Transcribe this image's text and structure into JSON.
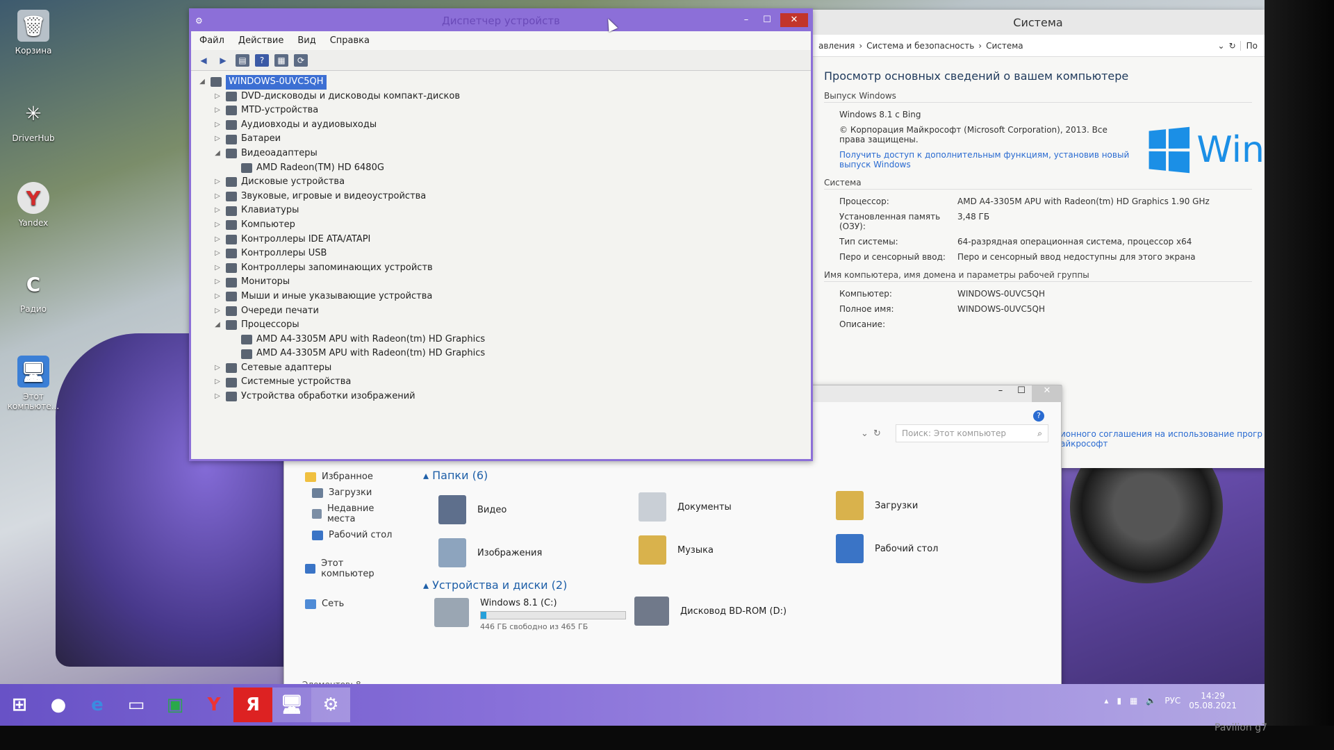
{
  "desktop": {
    "icons": [
      {
        "label": "Корзина",
        "icon": "recycle-bin-icon"
      },
      {
        "label": "DriverHub",
        "icon": "driverhub-icon"
      },
      {
        "label": "Yandex",
        "icon": "yandex-browser-icon"
      },
      {
        "label": "Радио",
        "icon": "radio-icon"
      },
      {
        "label": "Этот компьюте...",
        "icon": "computer-icon"
      }
    ]
  },
  "device_manager": {
    "title": "Диспетчер устройств",
    "menu": [
      "Файл",
      "Действие",
      "Вид",
      "Справка"
    ],
    "tree": [
      {
        "label": "WINDOWS-0UVC5QH",
        "expanded": true,
        "level": 0
      },
      {
        "label": "DVD-дисководы и дисководы компакт-дисков",
        "level": 1
      },
      {
        "label": "MTD-устройства",
        "level": 1
      },
      {
        "label": "Аудиовходы и аудиовыходы",
        "level": 1
      },
      {
        "label": "Батареи",
        "level": 1
      },
      {
        "label": "Видеоадаптеры",
        "level": 1,
        "expanded": true
      },
      {
        "label": "AMD Radeon(TM) HD 6480G",
        "level": 2
      },
      {
        "label": "Дисковые устройства",
        "level": 1
      },
      {
        "label": "Звуковые, игровые и видеоустройства",
        "level": 1
      },
      {
        "label": "Клавиатуры",
        "level": 1
      },
      {
        "label": "Компьютер",
        "level": 1
      },
      {
        "label": "Контроллеры IDE ATA/ATAPI",
        "level": 1
      },
      {
        "label": "Контроллеры USB",
        "level": 1
      },
      {
        "label": "Контроллеры запоминающих устройств",
        "level": 1
      },
      {
        "label": "Мониторы",
        "level": 1
      },
      {
        "label": "Мыши и иные указывающие устройства",
        "level": 1
      },
      {
        "label": "Очереди печати",
        "level": 1
      },
      {
        "label": "Процессоры",
        "level": 1,
        "expanded": true
      },
      {
        "label": "AMD A4-3305M APU with Radeon(tm) HD Graphics",
        "level": 2
      },
      {
        "label": "AMD A4-3305M APU with Radeon(tm) HD Graphics",
        "level": 2
      },
      {
        "label": "Сетевые адаптеры",
        "level": 1
      },
      {
        "label": "Системные устройства",
        "level": 1
      },
      {
        "label": "Устройства обработки изображений",
        "level": 1
      }
    ]
  },
  "system": {
    "title": "Система",
    "breadcrumb": [
      "авления",
      "Система и безопасность",
      "Система"
    ],
    "search_stub": "По",
    "heading": "Просмотр основных сведений о вашем компьютере",
    "edition_label": "Выпуск Windows",
    "edition": "Windows 8.1 с Bing",
    "copyright": "© Корпорация Майкрософт (Microsoft Corporation), 2013. Все права защищены.",
    "upgrade_link": "Получить доступ к дополнительным функциям, установив новый выпуск Windows",
    "logo_text": "Win",
    "system_label": "Система",
    "rows": [
      {
        "k": "Процессор:",
        "v": "AMD A4-3305M APU with Radeon(tm) HD Graphics   1.90 GHz"
      },
      {
        "k": "Установленная память (ОЗУ):",
        "v": "3,48 ГБ"
      },
      {
        "k": "Тип системы:",
        "v": "64-разрядная операционная система, процессор x64"
      },
      {
        "k": "Перо и сенсорный ввод:",
        "v": "Перо и сенсорный ввод недоступны для этого экрана"
      }
    ],
    "name_label": "Имя компьютера, имя домена и параметры рабочей группы",
    "name_rows": [
      {
        "k": "Компьютер:",
        "v": "WINDOWS-0UVC5QH"
      },
      {
        "k": "Полное имя:",
        "v": "WINDOWS-0UVC5QH"
      },
      {
        "k": "Описание:",
        "v": ""
      }
    ],
    "license_link": "ионного соглашения на использование прогр",
    "license_link2": "айкрософт"
  },
  "explorer": {
    "search_placeholder": "Поиск: Этот компьютер",
    "nav": [
      {
        "label": "Избранное",
        "sub": false
      },
      {
        "label": "Загрузки",
        "sub": true
      },
      {
        "label": "Недавние места",
        "sub": true
      },
      {
        "label": "Рабочий стол",
        "sub": true
      },
      {
        "label": "Этот компьютер",
        "sub": false
      },
      {
        "label": "Сеть",
        "sub": false
      }
    ],
    "folders_header": "Папки (6)",
    "folders": [
      "Видео",
      "Документы",
      "Загрузки",
      "Изображения",
      "Музыка",
      "Рабочий стол"
    ],
    "drives_header": "Устройства и диски (2)",
    "drive_c": {
      "name": "Windows 8.1 (C:)",
      "free": "446 ГБ свободно из 465 ГБ",
      "used_fraction": 0.04
    },
    "drive_d": "Дисковод BD-ROM (D:)",
    "status": "Элементов: 8"
  },
  "taskbar": {
    "lang": "РУС",
    "time": "14:29",
    "date": "05.08.2021"
  },
  "monitor_brand": "Pavilion g7"
}
